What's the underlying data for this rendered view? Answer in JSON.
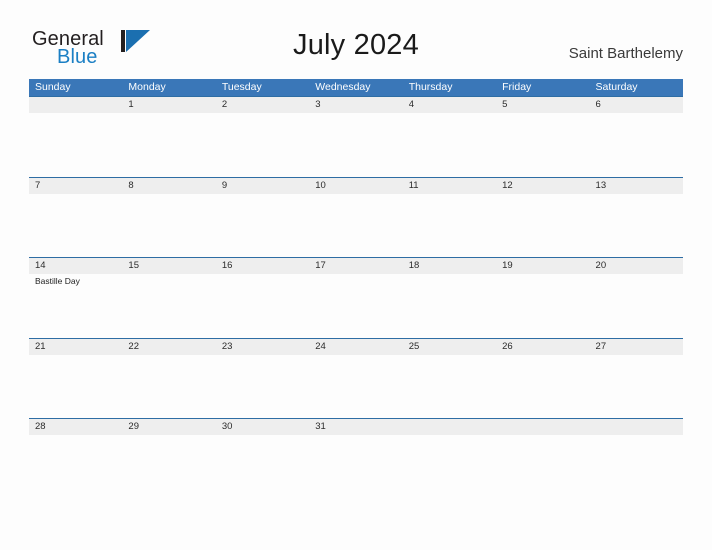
{
  "brand": {
    "name_part1": "General",
    "name_part2": "Blue",
    "mark_icon": "triangle-flag-icon",
    "color_dark": "#231f20",
    "color_blue": "#1b7fc4"
  },
  "header": {
    "title": "July 2024",
    "location": "Saint Barthelemy"
  },
  "calendar": {
    "header_bg": "#3a77b8",
    "band_bg": "#eeeeee",
    "band_border": "#2e6da4",
    "weekdays": [
      "Sunday",
      "Monday",
      "Tuesday",
      "Wednesday",
      "Thursday",
      "Friday",
      "Saturday"
    ],
    "weeks": [
      {
        "days": [
          {
            "num": "",
            "events": []
          },
          {
            "num": "1",
            "events": []
          },
          {
            "num": "2",
            "events": []
          },
          {
            "num": "3",
            "events": []
          },
          {
            "num": "4",
            "events": []
          },
          {
            "num": "5",
            "events": []
          },
          {
            "num": "6",
            "events": []
          }
        ]
      },
      {
        "days": [
          {
            "num": "7",
            "events": []
          },
          {
            "num": "8",
            "events": []
          },
          {
            "num": "9",
            "events": []
          },
          {
            "num": "10",
            "events": []
          },
          {
            "num": "11",
            "events": []
          },
          {
            "num": "12",
            "events": []
          },
          {
            "num": "13",
            "events": []
          }
        ]
      },
      {
        "days": [
          {
            "num": "14",
            "events": [
              "Bastille Day"
            ]
          },
          {
            "num": "15",
            "events": []
          },
          {
            "num": "16",
            "events": []
          },
          {
            "num": "17",
            "events": []
          },
          {
            "num": "18",
            "events": []
          },
          {
            "num": "19",
            "events": []
          },
          {
            "num": "20",
            "events": []
          }
        ]
      },
      {
        "days": [
          {
            "num": "21",
            "events": []
          },
          {
            "num": "22",
            "events": []
          },
          {
            "num": "23",
            "events": []
          },
          {
            "num": "24",
            "events": []
          },
          {
            "num": "25",
            "events": []
          },
          {
            "num": "26",
            "events": []
          },
          {
            "num": "27",
            "events": []
          }
        ]
      },
      {
        "days": [
          {
            "num": "28",
            "events": []
          },
          {
            "num": "29",
            "events": []
          },
          {
            "num": "30",
            "events": []
          },
          {
            "num": "31",
            "events": []
          },
          {
            "num": "",
            "events": []
          },
          {
            "num": "",
            "events": []
          },
          {
            "num": "",
            "events": []
          }
        ]
      }
    ]
  }
}
